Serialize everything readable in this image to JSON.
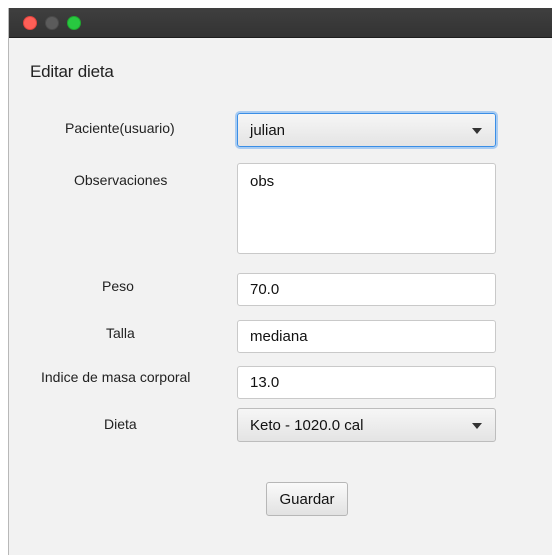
{
  "window": {
    "heading": "Editar dieta"
  },
  "form": {
    "paciente": {
      "label": "Paciente(usuario)",
      "selected": "julian"
    },
    "observaciones": {
      "label": "Observaciones",
      "value": "obs"
    },
    "peso": {
      "label": "Peso",
      "value": "70.0"
    },
    "talla": {
      "label": "Talla",
      "value": "mediana"
    },
    "imc": {
      "label": "Indice de masa corporal",
      "value": "13.0"
    },
    "dieta": {
      "label": "Dieta",
      "selected": "Keto - 1020.0 cal"
    }
  },
  "actions": {
    "save_label": "Guardar"
  },
  "colors": {
    "close": "#fe5f57",
    "minimize": "#5b5b5b",
    "zoom": "#28c840",
    "focus_ring": "#3a8ee6"
  },
  "icons": [
    "close-icon",
    "minimize-icon",
    "zoom-icon",
    "chevron-down-icon"
  ]
}
